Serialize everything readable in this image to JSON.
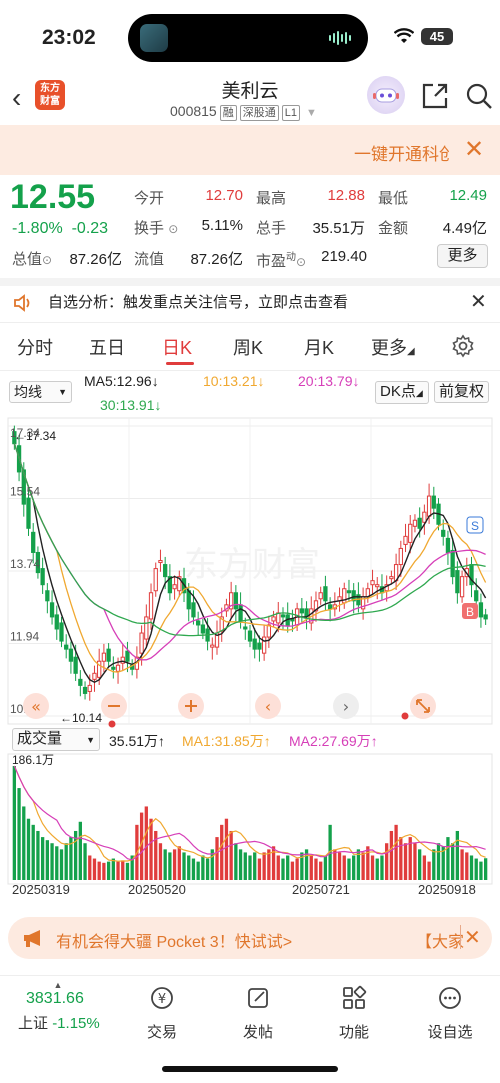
{
  "status": {
    "time": "23:02",
    "battery": "45"
  },
  "header": {
    "title": "美利云",
    "code": "000815",
    "tags": [
      "融",
      "深股通",
      "L1"
    ],
    "logo_text": "东方财富"
  },
  "banner": {
    "text": "一键开通科创板",
    "close": "✕"
  },
  "quote": {
    "price": "12.55",
    "change_pct": "-1.80%",
    "change": "-0.23",
    "open_label": "今开",
    "open": "12.70",
    "high_label": "最高",
    "high": "12.88",
    "low_label": "最低",
    "low": "12.49",
    "turnover_label": "换手",
    "turnover": "5.11%",
    "volume_label": "总手",
    "volume": "35.51万",
    "amount_label": "金额",
    "amount": "4.49亿",
    "mktcap_label": "总值",
    "mktcap": "87.26亿",
    "float_label": "流值",
    "float": "87.26亿",
    "pe_label": "市盈",
    "pe_sup": "动",
    "pe": "219.40",
    "more": "更多"
  },
  "analysis": {
    "text": "自选分析：触发重点关注信号，立即点击查看"
  },
  "tabs": [
    "分时",
    "五日",
    "日K",
    "周K",
    "月K",
    "更多"
  ],
  "chart_controls": {
    "ma_select": "均线",
    "ma5": "MA5:12.96↓",
    "ma10": "10:13.21↓",
    "ma20": "20:13.79↓",
    "ma30": "30:13.91↓",
    "dk": "DK点",
    "adjust": "前复权",
    "vol_select": "成交量",
    "vol": "35.51万↑",
    "vol_ma1": "MA1:31.85万↑",
    "vol_ma2": "MA2:27.69万↑"
  },
  "chart_labels": {
    "y_ticks": [
      "17.34",
      "15.54",
      "13.74",
      "11.94",
      "10.14"
    ],
    "max_mark": "17.34",
    "min_mark": "10.14",
    "vol_max": "186.1万",
    "dates": [
      "20250319",
      "20250520",
      "20250721",
      "20250918"
    ],
    "sell_mark": "S",
    "buy_mark": "B",
    "watermark": "东方财富"
  },
  "colors": {
    "up": "#e03c3c",
    "down": "#14a14b",
    "ma5": "#222222",
    "ma10": "#f0a830",
    "ma20": "#d63fb8",
    "ma30": "#2fa84f"
  },
  "chart_data": {
    "type": "candlestick",
    "ylim": [
      10.14,
      17.34
    ],
    "y_ticks": [
      17.34,
      15.54,
      13.74,
      11.94,
      10.14
    ],
    "closes": [
      16.9,
      16.2,
      15.4,
      14.8,
      14.2,
      13.7,
      13.4,
      13.0,
      12.6,
      12.3,
      12.0,
      11.8,
      11.5,
      11.2,
      10.9,
      10.7,
      10.9,
      11.2,
      11.5,
      11.7,
      11.5,
      11.3,
      11.4,
      11.6,
      11.5,
      11.3,
      11.6,
      12.2,
      12.6,
      13.2,
      13.8,
      14.0,
      13.6,
      13.2,
      13.4,
      13.6,
      13.2,
      12.8,
      12.6,
      12.4,
      12.2,
      12.0,
      11.9,
      12.2,
      12.6,
      12.9,
      13.2,
      12.8,
      12.5,
      12.3,
      12.0,
      11.8,
      11.8,
      12.1,
      12.4,
      12.6,
      12.7,
      12.6,
      12.4,
      12.5,
      12.8,
      12.7,
      12.6,
      12.8,
      13.0,
      13.2,
      13.0,
      12.8,
      12.9,
      13.1,
      13.3,
      13.2,
      13.0,
      12.9,
      13.1,
      13.3,
      13.5,
      13.4,
      13.2,
      13.4,
      13.6,
      13.9,
      14.3,
      14.6,
      14.9,
      15.0,
      14.8,
      15.2,
      15.6,
      15.3,
      14.9,
      14.6,
      14.2,
      13.6,
      13.2,
      13.6,
      13.8,
      13.4,
      13.0,
      12.6,
      12.55
    ],
    "volumes": [
      186,
      150,
      120,
      100,
      90,
      80,
      70,
      65,
      60,
      55,
      50,
      60,
      70,
      80,
      95,
      60,
      40,
      35,
      30,
      28,
      30,
      35,
      30,
      32,
      28,
      40,
      90,
      110,
      120,
      100,
      80,
      60,
      50,
      45,
      50,
      55,
      45,
      40,
      35,
      30,
      40,
      35,
      50,
      70,
      90,
      100,
      80,
      60,
      50,
      45,
      40,
      45,
      35,
      45,
      50,
      55,
      40,
      35,
      40,
      30,
      35,
      45,
      50,
      40,
      35,
      30,
      40,
      90,
      50,
      45,
      40,
      35,
      40,
      50,
      45,
      55,
      40,
      35,
      40,
      60,
      80,
      90,
      70,
      60,
      70,
      60,
      50,
      40,
      30,
      50,
      60,
      55,
      70,
      60,
      80,
      50,
      45,
      40,
      35,
      30,
      35.5
    ]
  }
}
